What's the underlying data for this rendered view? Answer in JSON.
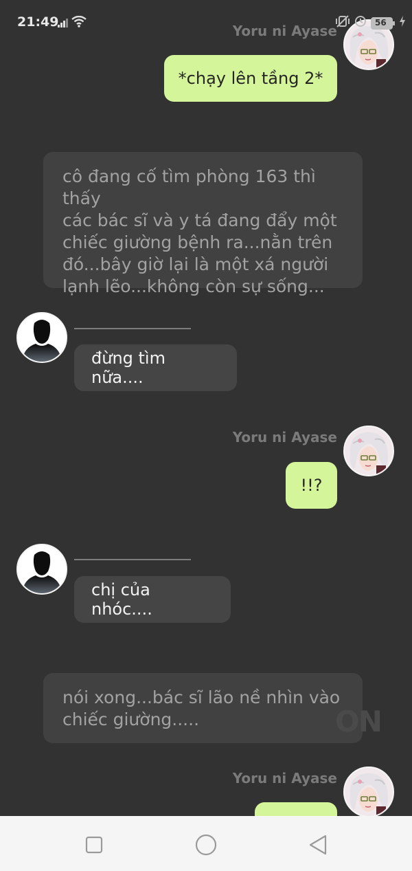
{
  "status_bar": {
    "time": "21:49",
    "icons": [
      "signal-icon",
      "wifi-icon",
      "vibrate-icon",
      "alarm-icon",
      "battery-icon"
    ],
    "battery_level": "56"
  },
  "messages": [
    {
      "type": "me",
      "sender": "Yoru ni Ayase",
      "text": "*chạy lên tầng 2*"
    },
    {
      "type": "narration",
      "lines": [
        "cô đang cố tìm phòng 163 thì thấy",
        "các bác sĩ và y tá đang đẩy một",
        "chiếc giường bệnh ra...nằn trên",
        "đó...bây giờ lại là một xá người",
        "lạnh lẽo...không còn sự sống..."
      ]
    },
    {
      "type": "other",
      "sender": "____________",
      "text": "đừng tìm nữa...."
    },
    {
      "type": "me",
      "sender": "Yoru ni Ayase",
      "text": "!!?"
    },
    {
      "type": "other",
      "sender": "____________",
      "text": "chị của nhóc...."
    },
    {
      "type": "narration",
      "lines": [
        "nói xong...bác sĩ lão nề nhìn vào",
        "chiếc giường....."
      ]
    },
    {
      "type": "me",
      "sender": "Yoru ni Ayase",
      "text": ""
    }
  ],
  "watermark": "ON",
  "nav": {
    "icons": [
      "recent-apps-icon",
      "home-icon",
      "back-icon"
    ]
  },
  "colors": {
    "background": "#323232",
    "my_bubble": "#d4f59a",
    "other_bubble": "#454545",
    "narration_bubble": "#414141",
    "nav_bar": "#f5f5f5"
  }
}
